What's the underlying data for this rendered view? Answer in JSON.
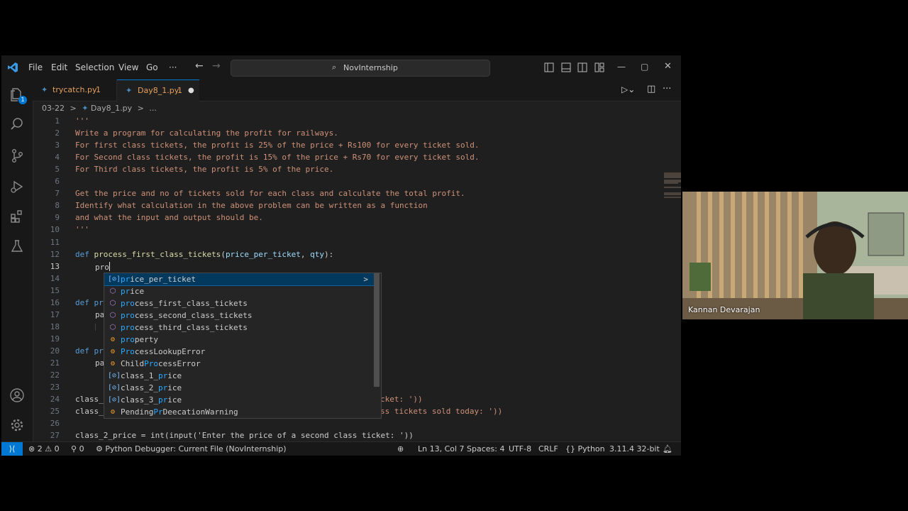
{
  "menu": [
    "File",
    "Edit",
    "Selection",
    "View",
    "Go",
    "···"
  ],
  "search": {
    "label": "NovInternship"
  },
  "tabs": [
    {
      "name": "trycatch.py",
      "badge": "1",
      "color": "#e5a05a"
    },
    {
      "name": "Day8_1.py",
      "badge": "1",
      "color": "#e5a05a",
      "dirty_dot": "●"
    }
  ],
  "breadcrumb": {
    "folder": "03-22",
    "sep1": ">",
    "file": "Day8_1.py",
    "sep2": ">",
    "more": "..."
  },
  "activity_badge": "1",
  "lines": [
    {
      "n": "1",
      "text": "'''"
    },
    {
      "n": "2",
      "text": "Write a program for calculating the profit for railways."
    },
    {
      "n": "3",
      "text": "For first class tickets, the profit is 25% of the price + Rs100 for every ticket sold."
    },
    {
      "n": "4",
      "text": "For Second class tickets, the profit is 15% of the price + Rs70 for every ticket sold."
    },
    {
      "n": "5",
      "text": "For Third class tickets, the profit is 5% of the price."
    },
    {
      "n": "6",
      "text": ""
    },
    {
      "n": "7",
      "text": "Get the price and no of tickets sold for each class and calculate the total profit."
    },
    {
      "n": "8",
      "text": "Identify what calculation in the above problem can be written as a function"
    },
    {
      "n": "9",
      "text": "and what the input and output should be."
    },
    {
      "n": "10",
      "text": "'''"
    },
    {
      "n": "11",
      "text": ""
    },
    {
      "n": "12",
      "def": "def",
      "fname": "process_first_class_tickets",
      "p1": "price_per_ticket",
      "p2": "qty"
    },
    {
      "n": "13",
      "text": "pro"
    },
    {
      "n": "14",
      "text": ""
    },
    {
      "n": "15",
      "text": ""
    },
    {
      "n": "16",
      "text": "def pr"
    },
    {
      "n": "17",
      "text": "pa"
    },
    {
      "n": "18",
      "text": ""
    },
    {
      "n": "19",
      "text": ""
    },
    {
      "n": "20",
      "text": "def pr"
    },
    {
      "n": "21",
      "text": "pa"
    },
    {
      "n": "22",
      "text": ""
    },
    {
      "n": "23",
      "text": ""
    },
    {
      "n": "24",
      "text": "class_",
      "tail": "cket: '))"
    },
    {
      "n": "25",
      "text": "class_",
      "tail": "ss tickets sold today: '))"
    },
    {
      "n": "26",
      "text": ""
    },
    {
      "n": "27",
      "text": "class_2_price = int(input('Enter the price of a second class ticket: '))"
    }
  ],
  "suggestions": [
    {
      "kind": "var",
      "icon": "[⊘]",
      "match": "pr",
      "rest": "ice_per_ticket",
      "arrow": ">"
    },
    {
      "kind": "fn",
      "icon": "⬡",
      "match": "pr",
      "rest": "ice"
    },
    {
      "kind": "fn",
      "icon": "⬡",
      "match": "pro",
      "rest": "cess_first_class_tickets"
    },
    {
      "kind": "fn",
      "icon": "⬡",
      "match": "pro",
      "rest": "cess_second_class_tickets"
    },
    {
      "kind": "fn",
      "icon": "⬡",
      "match": "pro",
      "rest": "cess_third_class_tickets"
    },
    {
      "kind": "cls",
      "icon": "⚙",
      "match": "pro",
      "rest": "perty"
    },
    {
      "kind": "cls",
      "icon": "⚙",
      "match": "Pro",
      "rest": "cessLookupError"
    },
    {
      "kind": "cls",
      "icon": "⚙",
      "pre": "Child",
      "match": "Pro",
      "rest": "cessError"
    },
    {
      "kind": "var",
      "icon": "[⊘]",
      "pre": "class_1_",
      "match": "pr",
      "rest": "ice"
    },
    {
      "kind": "var",
      "icon": "[⊘]",
      "pre": "class_2_",
      "match": "pr",
      "rest": "ice"
    },
    {
      "kind": "var",
      "icon": "[⊘]",
      "pre": "class_3_",
      "match": "pr",
      "rest": "ice"
    },
    {
      "kind": "cls",
      "icon": "⚙",
      "pre": "Pending",
      "match": "Pr",
      "rest": "ecationWarning",
      "mid": "De"
    }
  ],
  "status": {
    "errors": "2",
    "warnings": "0",
    "ports": "0",
    "debugger": "Python Debugger: Current File (NovInternship)",
    "position": "Ln 13, Col 7",
    "spaces": "Spaces: 4",
    "encoding": "UTF-8",
    "eol": "CRLF",
    "language": "Python",
    "interpreter": "3.11.4 32-bit"
  },
  "webcam": {
    "name": "Kannan Devarajan"
  },
  "colors": {
    "accent": "#0078d4",
    "editor_bg": "#1f1f1f",
    "selection": "#04395e"
  }
}
